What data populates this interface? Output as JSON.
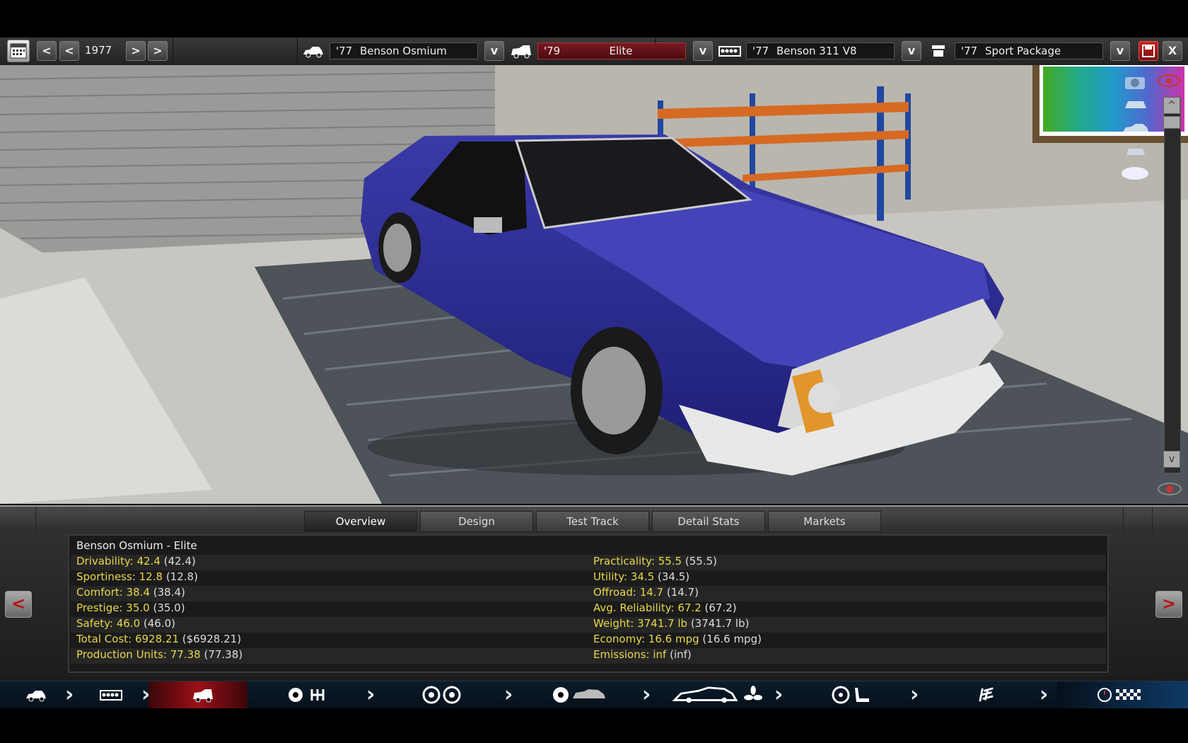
{
  "toolbar": {
    "year": "1977",
    "selectors": [
      {
        "year": "'77",
        "name": "Benson Osmium",
        "icon": "car-body-icon"
      },
      {
        "year": "'79",
        "name": "Elite",
        "icon": "car-trim-icon"
      },
      {
        "year": "'77",
        "name": "Benson 311 V8",
        "icon": "engine-icon"
      },
      {
        "year": "'77",
        "name": "Sport Package",
        "icon": "package-icon"
      }
    ],
    "dropdown_glyph": "v",
    "prev_glyph": "<",
    "next_glyph": ">",
    "close_glyph": "X"
  },
  "viewport": {
    "up_glyph": "^",
    "down_glyph": "v"
  },
  "tabs": [
    {
      "label": "Overview",
      "active": true
    },
    {
      "label": "Design",
      "active": false
    },
    {
      "label": "Test Track",
      "active": false
    },
    {
      "label": "Detail Stats",
      "active": false
    },
    {
      "label": "Markets",
      "active": false
    }
  ],
  "overview": {
    "title": "Benson Osmium - Elite",
    "left": [
      {
        "key": "Drivability: 42.4",
        "prev": "(42.4)"
      },
      {
        "key": "Sportiness: 12.8",
        "prev": "(12.8)"
      },
      {
        "key": "Comfort: 38.4",
        "prev": "(38.4)"
      },
      {
        "key": "Prestige: 35.0",
        "prev": "(35.0)"
      },
      {
        "key": "Safety: 46.0",
        "prev": "(46.0)"
      },
      {
        "key": "Total Cost: 6928.21",
        "prev": "($6928.21)"
      },
      {
        "key": "Production Units: 77.38",
        "prev": "(77.38)"
      }
    ],
    "right": [
      {
        "key": "Practicality: 55.5",
        "prev": "(55.5)"
      },
      {
        "key": "Utility: 34.5",
        "prev": "(34.5)"
      },
      {
        "key": "Offroad: 14.7",
        "prev": "(14.7)"
      },
      {
        "key": "Avg. Reliability: 67.2",
        "prev": "(67.2)"
      },
      {
        "key": "Weight: 3741.7 lb",
        "prev": "(3741.7 lb)"
      },
      {
        "key": "Economy: 16.6 mpg",
        "prev": "(16.6 mpg)"
      },
      {
        "key": "Emissions: inf",
        "prev": "(inf)"
      }
    ]
  },
  "bottom_nav": [
    "chassis",
    "engine",
    "trim",
    "transmission",
    "wheels",
    "brakes-body",
    "aero-cooling",
    "interior",
    "suspension",
    "testing"
  ],
  "colors": {
    "car": "#2b2a8f",
    "accent_red": "#9a1018",
    "stat_key": "#e8d84a"
  }
}
